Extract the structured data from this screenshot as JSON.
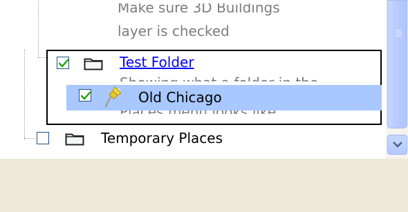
{
  "tree": {
    "description_lines": [
      "Make sure 3D Buildings",
      "layer is checked"
    ],
    "items": [
      {
        "label": "Test Folder",
        "checked": true,
        "icon": "folder-icon",
        "style": "link"
      },
      {
        "label": "Temporary Places",
        "checked": false,
        "icon": "folder-icon",
        "style": "normal"
      }
    ],
    "test_folder_description": [
      "Showing what a folder in the",
      "Places menu looks like."
    ],
    "drag_item": {
      "label": "Old Chicago",
      "checked": true,
      "icon": "pushpin-icon",
      "highlight_color": "#A8C8FF"
    }
  },
  "scrollbar": {
    "track_color": "#F4F3EE",
    "thumb_color": "#B9CBFF",
    "down_arrow_icon": "chevron-down-icon"
  },
  "colors": {
    "link": "#0000FF",
    "description": "#7D7D7D",
    "panel_background": "#FFFFFF",
    "window_background": "#ECE9D8",
    "checkbox_border": "#1C5180",
    "checkmark": "#22A000"
  }
}
